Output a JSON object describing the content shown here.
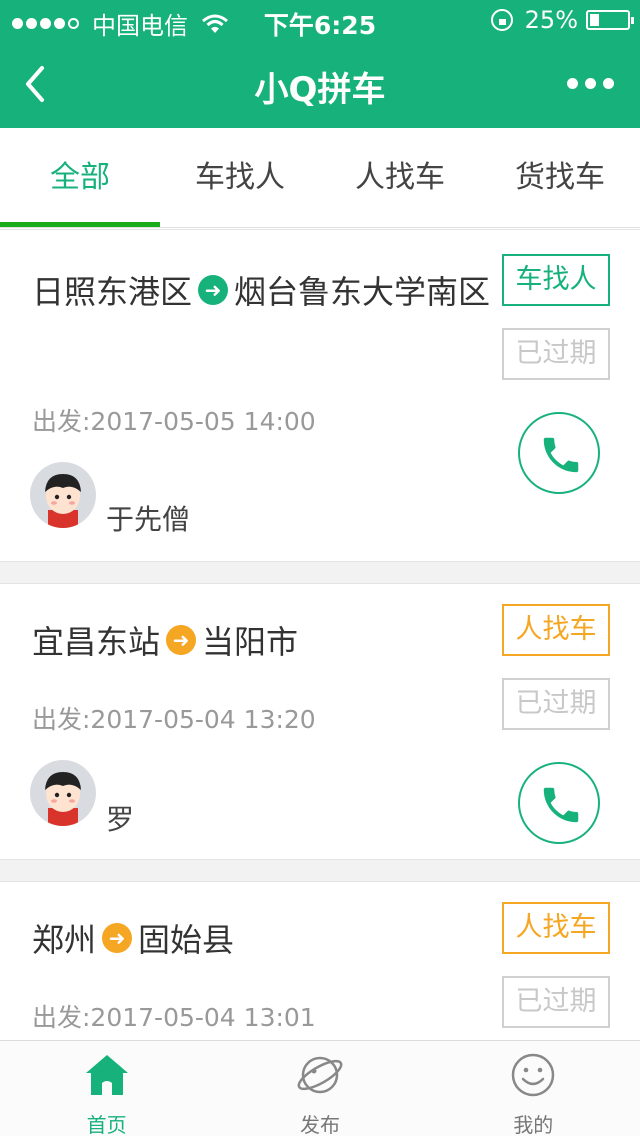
{
  "status_bar": {
    "carrier": "中国电信",
    "time": "下午6:25",
    "battery": "25%",
    "battery_level": 0.25
  },
  "nav": {
    "title": "小Q拼车"
  },
  "tabs": [
    {
      "label": "全部",
      "active": true
    },
    {
      "label": "车找人",
      "active": false
    },
    {
      "label": "人找车",
      "active": false
    },
    {
      "label": "货找车",
      "active": false
    }
  ],
  "posts": [
    {
      "from": "日照东港区",
      "to": "烟台鲁东大学南区",
      "depart": "出发:2017-05-05 14:00",
      "type": "车找人",
      "type_color": "#17b27c",
      "status": "已过期",
      "user": "于先僧"
    },
    {
      "from": "宜昌东站",
      "to": "当阳市",
      "depart": "出发:2017-05-04 13:20",
      "type": "人找车",
      "type_color": "#f5a623",
      "status": "已过期",
      "user": "罗"
    },
    {
      "from": "郑州",
      "to": "固始县",
      "depart": "出发:2017-05-04 13:01",
      "type": "人找车",
      "type_color": "#f5a623",
      "status": "已过期",
      "user": ""
    }
  ],
  "tabbar": [
    {
      "label": "首页",
      "icon": "home-icon",
      "active": true
    },
    {
      "label": "发布",
      "icon": "planet-icon",
      "active": false
    },
    {
      "label": "我的",
      "icon": "smiley-icon",
      "active": false
    }
  ],
  "colors": {
    "brand": "#17b27c",
    "orange": "#f5a623",
    "tab_indicator": "#1aad19"
  }
}
